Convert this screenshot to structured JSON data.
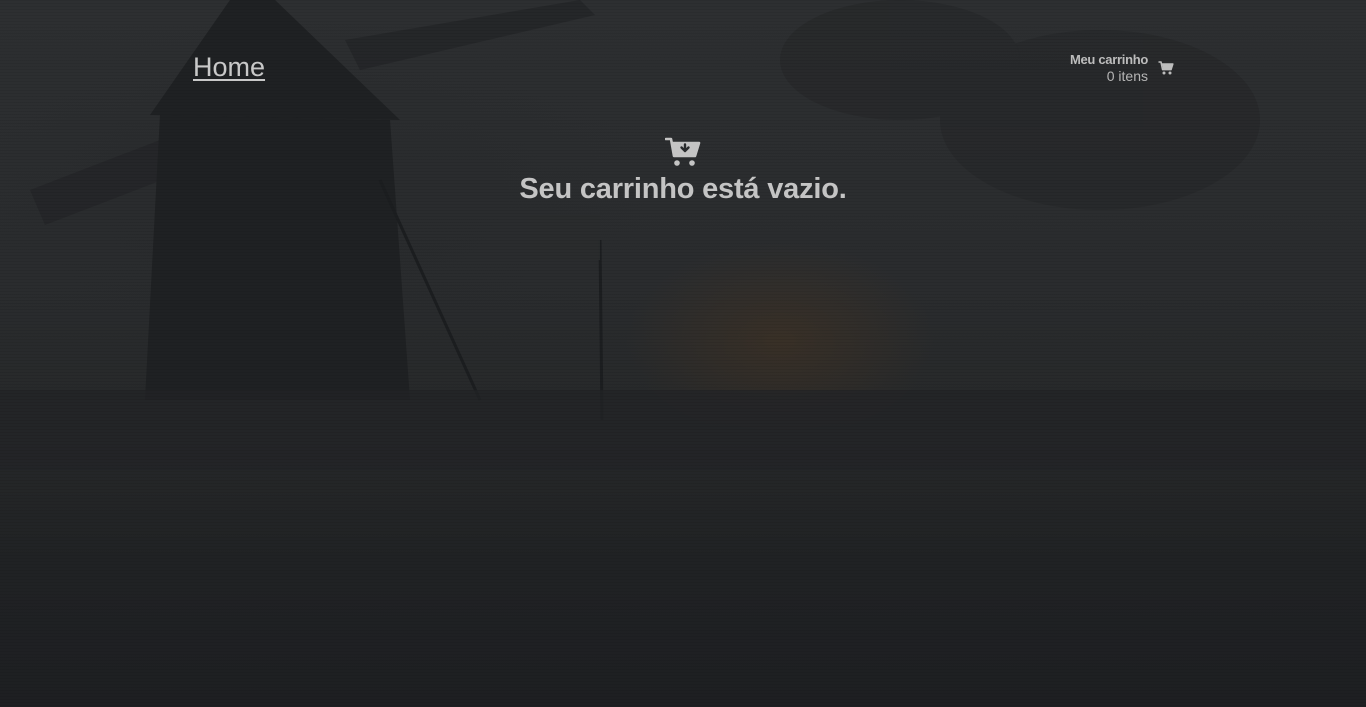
{
  "header": {
    "home_label": "Home"
  },
  "cart_widget": {
    "title": "Meu carrinho",
    "count_text": "0 itens",
    "icon": "shopping-cart-icon"
  },
  "main": {
    "empty_icon": "cart-arrow-down-icon",
    "empty_message": "Seu carrinho está vazio."
  },
  "colors": {
    "text": "#c4c4c4",
    "background": "#25272a"
  }
}
